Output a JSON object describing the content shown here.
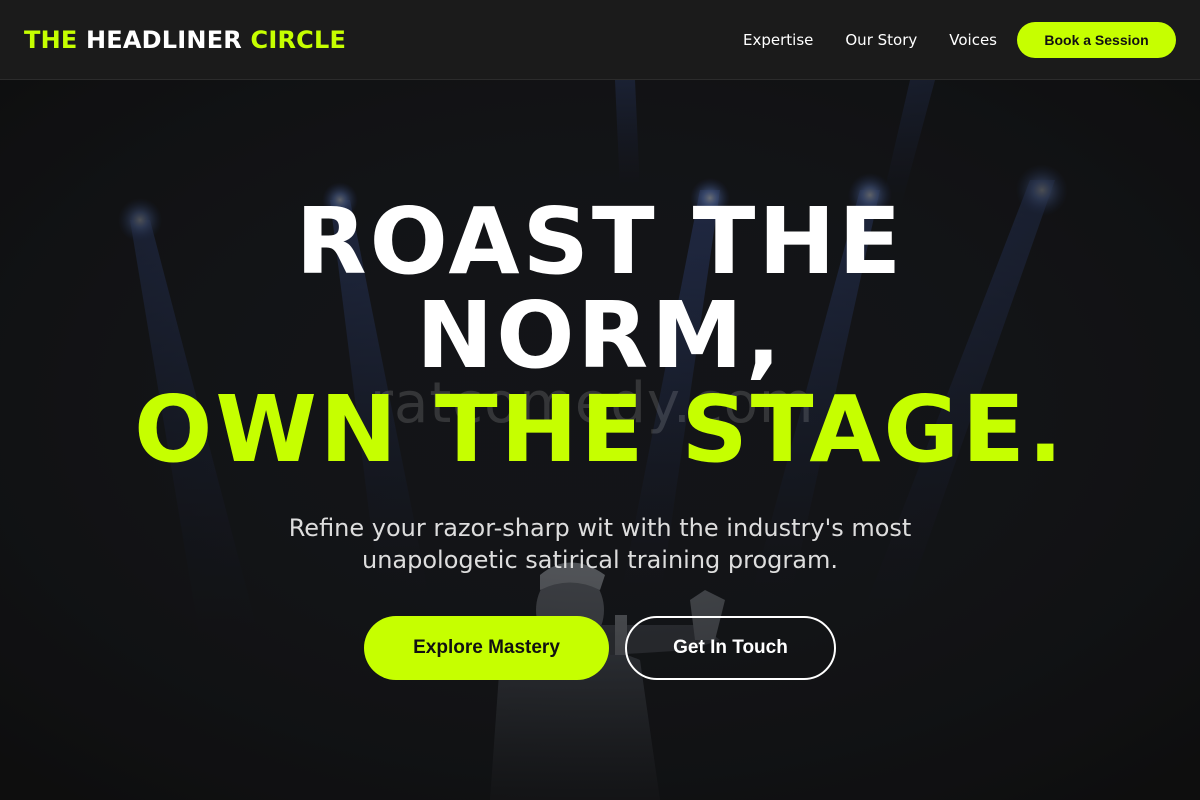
{
  "brand": {
    "logo_part1": "THE",
    "logo_part2": "HEADLINER",
    "logo_part3": "CIRCLE",
    "accent_color": "#c6ff00"
  },
  "nav": {
    "links": [
      "Expertise",
      "Our Story",
      "Voices"
    ],
    "cta_label": "Book a Session"
  },
  "hero": {
    "headline_line1": "ROAST THE",
    "headline_line2": "NORM,",
    "headline_line3": "OWN THE STAGE.",
    "subtitle_line1": "Refine your razor-sharp wit with the industry's most",
    "subtitle_line2": "unapologetic satirical training program.",
    "primary_button": "Explore Mastery",
    "secondary_button": "Get In Touch",
    "watermark": "ratcomedy.com",
    "background_image": "performer-on-stage-with-spotlights"
  }
}
